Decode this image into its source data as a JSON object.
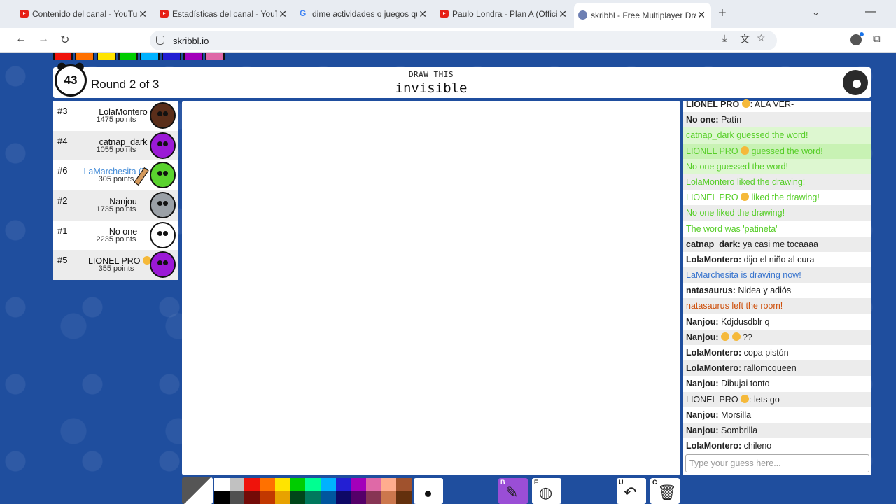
{
  "browser": {
    "tabs": [
      {
        "title": "Contenido del canal - YouTube",
        "favicon": "youtube-icon"
      },
      {
        "title": "Estadísticas del canal - YouTube",
        "favicon": "youtube-icon"
      },
      {
        "title": "dime actividades o juegos que",
        "favicon": "google-icon"
      },
      {
        "title": "Paulo Londra - Plan A (Official V",
        "favicon": "youtube-icon"
      },
      {
        "title": "skribbl - Free Multiplayer Drawi",
        "favicon": "skribbl-icon",
        "active": true
      }
    ],
    "close_glyph": "✕",
    "new_tab_glyph": "+",
    "url": "skribbl.io"
  },
  "game": {
    "timer": "43",
    "round_text": "Round 2 of 3",
    "draw_label": "DRAW THIS",
    "word": "invisible"
  },
  "players": [
    {
      "rank": "#3",
      "name": "LolaMontero",
      "points": "1475 points",
      "avatar_color": "#5a2e1a"
    },
    {
      "rank": "#4",
      "name": "catnap_dark",
      "points": "1055 points",
      "avatar_color": "#9b19d6"
    },
    {
      "rank": "#6",
      "name": "LaMarchesita (Y",
      "points": "305 points",
      "avatar_color": "#5ad32e",
      "is_me": true,
      "drawing": true
    },
    {
      "rank": "#2",
      "name": "Nanjou",
      "points": "1735 points",
      "avatar_color": "#9aa0a6"
    },
    {
      "rank": "#1",
      "name": "No one",
      "points": "2235 points",
      "avatar_color": "#ffffff"
    },
    {
      "rank": "#5",
      "name": "LIONEL PRO",
      "points": "355 points",
      "avatar_color": "#9b19d6",
      "emoji": "sunglasses"
    }
  ],
  "chat": {
    "messages": [
      {
        "author": "LIONEL PRO",
        "emoji": true,
        "text": ": ALA VER-",
        "style": "normal"
      },
      {
        "author": "No one:",
        "text": " Patín",
        "style": "normal"
      },
      {
        "text": "catnap_dark guessed the word!",
        "style": "guessed"
      },
      {
        "text": "LIONEL PRO",
        "emoji_after": true,
        "text2": " guessed the word!",
        "style": "guessed"
      },
      {
        "text": "No one guessed the word!",
        "style": "guessed"
      },
      {
        "text": "LolaMontero liked the drawing!",
        "style": "green"
      },
      {
        "text": "LIONEL PRO",
        "emoji_after": true,
        "text2": " liked the drawing!",
        "style": "green"
      },
      {
        "text": "No one liked the drawing!",
        "style": "green"
      },
      {
        "text": "The word was 'patineta'",
        "style": "green"
      },
      {
        "author": "catnap_dark:",
        "text": " ya casi me tocaaaa",
        "style": "normal"
      },
      {
        "author": "LolaMontero:",
        "text": " dijo el niño al cura",
        "style": "normal"
      },
      {
        "text": "LaMarchesita is drawing now!",
        "style": "blue"
      },
      {
        "author": "natasaurus:",
        "text": " Nidea y adiós",
        "style": "normal"
      },
      {
        "text": "natasaurus left the room!",
        "style": "red"
      },
      {
        "author": "Nanjou:",
        "text": " Kdjdusdblr q",
        "style": "normal"
      },
      {
        "author": "Nanjou:",
        "text": " ??",
        "two_emoji": true,
        "style": "normal"
      },
      {
        "author": "LolaMontero:",
        "text": " copa pistón",
        "style": "normal"
      },
      {
        "author": "LolaMontero:",
        "text": " rallomcqueen",
        "style": "normal"
      },
      {
        "author": "Nanjou:",
        "text": " Dibujai tonto",
        "style": "normal"
      },
      {
        "author": "LIONEL PRO",
        "emoji": true,
        "text": ": lets go",
        "style": "normal"
      },
      {
        "author": "Nanjou:",
        "text": " Morsilla",
        "style": "normal"
      },
      {
        "author": "Nanjou:",
        "text": " Sombrilla",
        "style": "normal"
      },
      {
        "author": "LolaMontero:",
        "text": " chileno",
        "style": "normal"
      }
    ],
    "input_placeholder": "Type your guess here..."
  },
  "toolbar": {
    "colors_top": [
      "#ffffff",
      "#c1c1c1",
      "#ef130b",
      "#ff7100",
      "#ffe400",
      "#00cc00",
      "#00ff91",
      "#00b2ff",
      "#231fd3",
      "#a300ba",
      "#df69a7",
      "#ffac8e",
      "#a0522d"
    ],
    "colors_bottom": [
      "#000000",
      "#505050",
      "#740b07",
      "#c23800",
      "#e8a200",
      "#004619",
      "#00785d",
      "#00569e",
      "#0e0865",
      "#550069",
      "#873554",
      "#cc774d",
      "#63300d"
    ],
    "tools": [
      {
        "key": "B",
        "name": "pencil"
      },
      {
        "key": "F",
        "name": "fill"
      },
      {
        "key": "U",
        "name": "undo"
      },
      {
        "key": "C",
        "name": "clear"
      }
    ]
  }
}
